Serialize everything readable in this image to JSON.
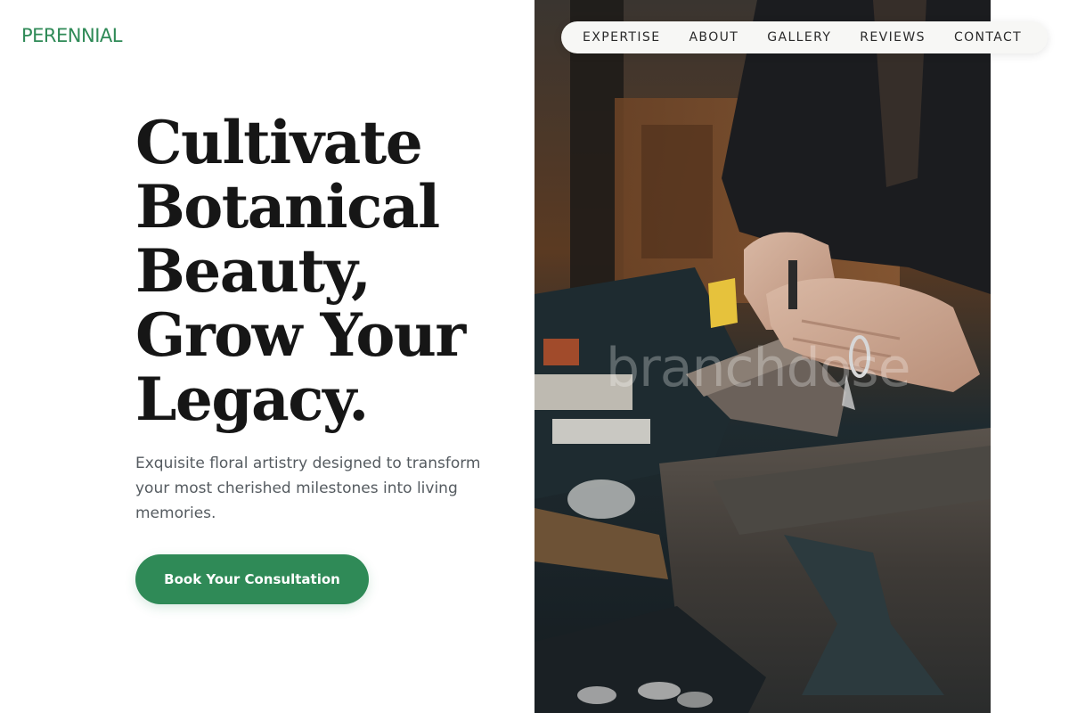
{
  "brand": {
    "logo_text": "PERENNIAL"
  },
  "nav": {
    "items": [
      {
        "label": "EXPERTISE"
      },
      {
        "label": "ABOUT"
      },
      {
        "label": "GALLERY"
      },
      {
        "label": "REVIEWS"
      },
      {
        "label": "CONTACT"
      }
    ]
  },
  "hero": {
    "headline_lines": [
      "Cultivate",
      "Botanical",
      "Beauty,",
      "Grow Your",
      "Legacy."
    ],
    "subtext": "Exquisite floral artistry designed to transform your most cherished milestones into living memories.",
    "cta_label": "Book Your Consultation",
    "image_watermark": "branchdose"
  },
  "colors": {
    "brand_green": "#2f8a57",
    "headline": "#161616",
    "body_text": "#555b60",
    "nav_bg": "#f7f7f5"
  }
}
